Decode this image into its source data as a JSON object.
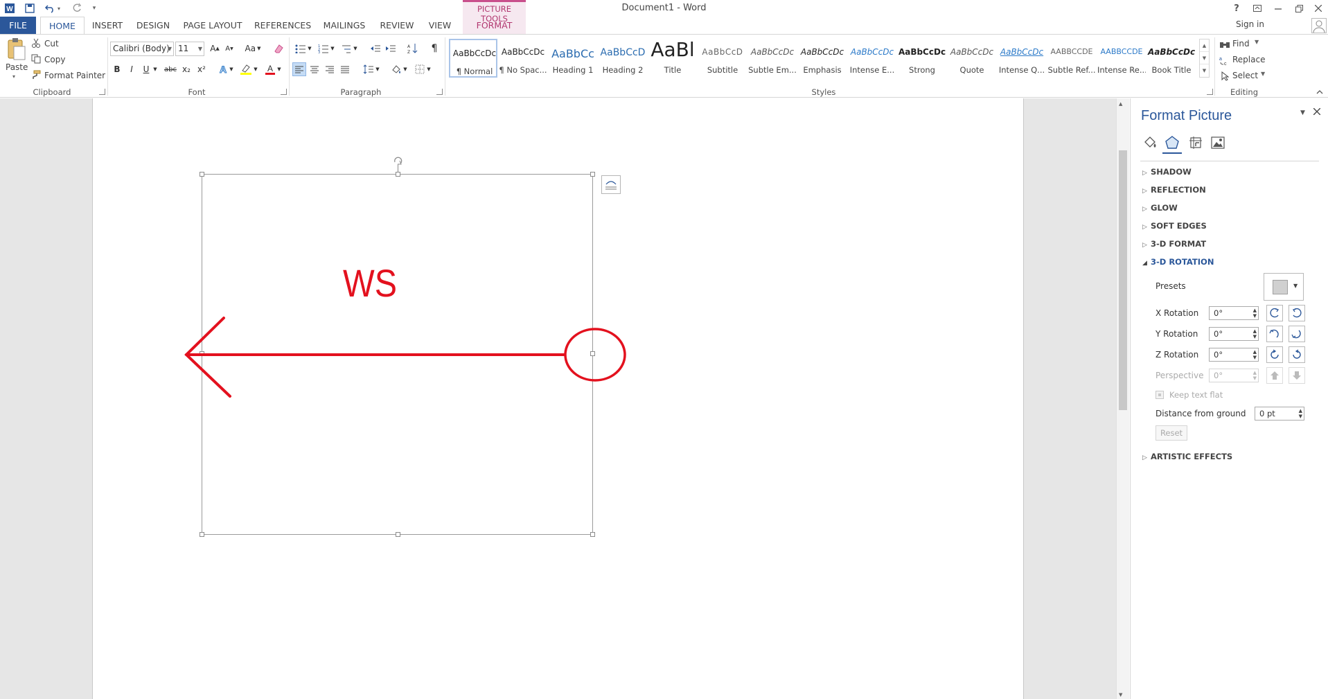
{
  "window": {
    "title": "Document1 - Word",
    "sign_in": "Sign in",
    "help": "?"
  },
  "tabs": {
    "file": "FILE",
    "home": "HOME",
    "insert": "INSERT",
    "design": "DESIGN",
    "page_layout": "PAGE LAYOUT",
    "references": "REFERENCES",
    "mailings": "MAILINGS",
    "review": "REVIEW",
    "view": "VIEW",
    "context_group": "PICTURE TOOLS",
    "format": "FORMAT"
  },
  "clipboard": {
    "paste": "Paste",
    "cut": "Cut",
    "copy": "Copy",
    "format_painter": "Format Painter",
    "label": "Clipboard"
  },
  "font": {
    "name": "Calibri (Body)",
    "size": "11",
    "case_btn": "Aa",
    "bold": "B",
    "italic": "I",
    "underline": "U",
    "strike": "abc",
    "sub": "x₂",
    "sup": "x²",
    "label": "Font"
  },
  "paragraph": {
    "label": "Paragraph"
  },
  "styles": {
    "label": "Styles",
    "items": [
      {
        "preview": "AaBbCcDc",
        "name": "¶ Normal"
      },
      {
        "preview": "AaBbCcDc",
        "name": "¶ No Spac..."
      },
      {
        "preview": "AaBbCc",
        "name": "Heading 1"
      },
      {
        "preview": "AaBbCcD",
        "name": "Heading 2"
      },
      {
        "preview": "AaBl",
        "name": "Title"
      },
      {
        "preview": "AaBbCcD",
        "name": "Subtitle"
      },
      {
        "preview": "AaBbCcDc",
        "name": "Subtle Em..."
      },
      {
        "preview": "AaBbCcDc",
        "name": "Emphasis"
      },
      {
        "preview": "AaBbCcDc",
        "name": "Intense E..."
      },
      {
        "preview": "AaBbCcDc",
        "name": "Strong"
      },
      {
        "preview": "AaBbCcDc",
        "name": "Quote"
      },
      {
        "preview": "AaBbCcDc",
        "name": "Intense Q..."
      },
      {
        "preview": "AABBCCDE",
        "name": "Subtle Ref..."
      },
      {
        "preview": "AABBCCDE",
        "name": "Intense Re..."
      },
      {
        "preview": "AaBbCcDc",
        "name": "Book Title"
      }
    ]
  },
  "editing": {
    "find": "Find",
    "replace": "Replace",
    "select": "Select",
    "label": "Editing"
  },
  "document": {
    "drawing_text": "WS"
  },
  "pane": {
    "title": "Format Picture",
    "sections": {
      "shadow": "SHADOW",
      "reflection": "REFLECTION",
      "glow": "GLOW",
      "soft_edges": "SOFT EDGES",
      "format_3d": "3-D FORMAT",
      "rotation_3d": "3-D ROTATION",
      "artistic": "ARTISTIC EFFECTS"
    },
    "presets_label": "Presets",
    "x_rotation_label": "X Rotation",
    "x_rotation_value": "0°",
    "y_rotation_label": "Y Rotation",
    "y_rotation_value": "0°",
    "z_rotation_label": "Z Rotation",
    "z_rotation_value": "0°",
    "perspective_label": "Perspective",
    "perspective_value": "0°",
    "keep_text_flat": "Keep text flat",
    "distance_label": "Distance from ground",
    "distance_value": "0 pt",
    "reset": "Reset"
  },
  "colors": {
    "accent": "#2b579a",
    "context_tab": "#c94f8c",
    "drawing_red": "#e3111e"
  }
}
